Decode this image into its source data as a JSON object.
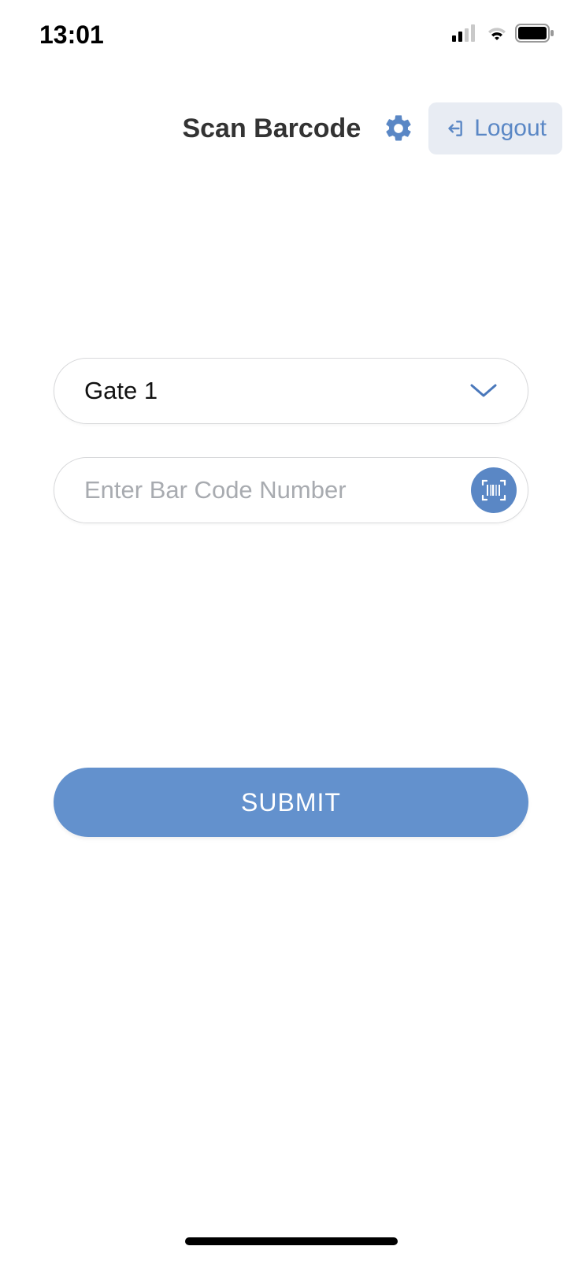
{
  "status": {
    "time": "13:01"
  },
  "header": {
    "title": "Scan Barcode",
    "logout_label": "Logout"
  },
  "form": {
    "gate_selected": "Gate 1",
    "barcode_placeholder": "Enter Bar Code Number",
    "barcode_value": "",
    "submit_label": "SUBMIT"
  },
  "colors": {
    "accent": "#5a87c5",
    "button_bg": "#6391cd",
    "logout_bg": "#e8ecf3"
  }
}
